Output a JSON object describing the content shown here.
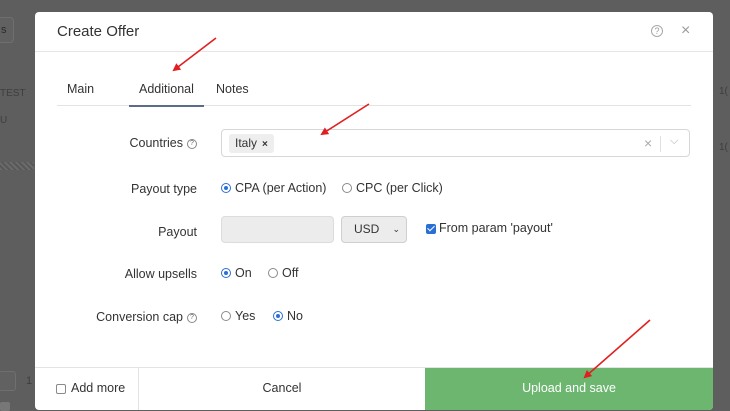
{
  "background": {
    "left_button_label": "s",
    "text_test": "TEST",
    "text_u": "U",
    "text_number": "1",
    "right_text_top": "1(",
    "right_text_mid": "1("
  },
  "modal": {
    "title": "Create Offer",
    "help_glyph": "?",
    "close_glyph": "×"
  },
  "tabs": [
    {
      "label": "Main"
    },
    {
      "label": "Additional"
    },
    {
      "label": "Notes"
    }
  ],
  "form": {
    "countries": {
      "label": "Countries",
      "selected": [
        "Italy"
      ],
      "chip_remove": "×",
      "clear_glyph": "×",
      "chevron_glyph": "⌵"
    },
    "payout_type": {
      "label": "Payout type",
      "options": [
        {
          "label": "CPA (per Action)",
          "checked": true
        },
        {
          "label": "CPC (per Click)",
          "checked": false
        }
      ]
    },
    "payout": {
      "label": "Payout",
      "value": "",
      "currency": "USD",
      "currency_chevron": "⌄",
      "from_param_label": "From param 'payout'",
      "from_param_checked": true
    },
    "allow_upsells": {
      "label": "Allow upsells",
      "options": [
        {
          "label": "On",
          "checked": true
        },
        {
          "label": "Off",
          "checked": false
        }
      ]
    },
    "conversion_cap": {
      "label": "Conversion cap",
      "options": [
        {
          "label": "Yes",
          "checked": false
        },
        {
          "label": "No",
          "checked": true
        }
      ]
    }
  },
  "footer": {
    "add_more_label": "Add more",
    "cancel_label": "Cancel",
    "upload_label": "Upload and save"
  },
  "colors": {
    "primary": "#2a6fd6",
    "upload_button": "#6cb66f",
    "annotation_arrow": "#e02020",
    "overlay": "#5e5e5e"
  }
}
